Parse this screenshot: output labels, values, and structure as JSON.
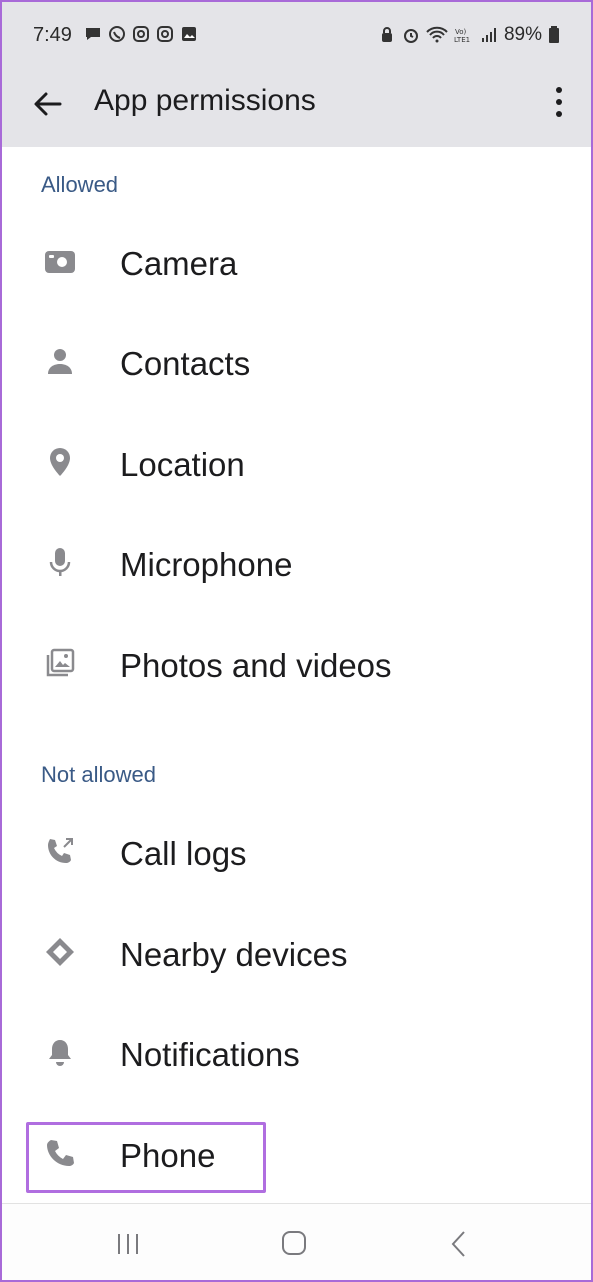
{
  "status_bar": {
    "time": "7:49",
    "battery": "89%",
    "left_icons": [
      "chat-icon",
      "whatsapp-icon",
      "instagram-icon",
      "instagram-icon",
      "gallery-icon"
    ],
    "right_icons": [
      "vpn-lock-icon",
      "alarm-icon",
      "wifi-icon",
      "volte-icon",
      "signal-icon",
      "battery-icon"
    ]
  },
  "app_bar": {
    "title": "App permissions",
    "back_icon": "arrow-left-icon",
    "more_icon": "more-vert-icon"
  },
  "sections": [
    {
      "header": "Allowed",
      "items": [
        {
          "label": "Camera",
          "icon": "camera-icon"
        },
        {
          "label": "Contacts",
          "icon": "person-icon"
        },
        {
          "label": "Location",
          "icon": "location-pin-icon"
        },
        {
          "label": "Microphone",
          "icon": "microphone-icon"
        },
        {
          "label": "Photos and videos",
          "icon": "photos-icon"
        }
      ]
    },
    {
      "header": "Not allowed",
      "items": [
        {
          "label": "Call logs",
          "icon": "call-log-icon"
        },
        {
          "label": "Nearby devices",
          "icon": "nearby-devices-icon"
        },
        {
          "label": "Notifications",
          "icon": "bell-icon"
        },
        {
          "label": "Phone",
          "icon": "phone-icon"
        }
      ]
    }
  ],
  "nav_bar": {
    "recents_icon": "recents-icon",
    "home_icon": "home-icon",
    "back_icon": "back-chevron-icon"
  },
  "colors": {
    "header_bg": "#e4e4e8",
    "section_header": "#3a5a86",
    "icon_grey": "#8a8a8e",
    "highlight": "#b06ee0"
  }
}
